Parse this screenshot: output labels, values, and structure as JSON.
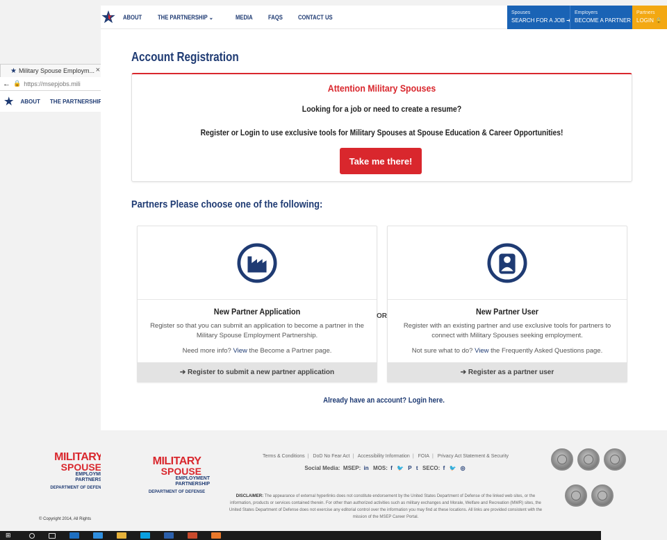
{
  "background_window": {
    "tab_title": "Military Spouse Employm...",
    "address": "https://msepjobs.mili",
    "nav_items": [
      "ABOUT",
      "THE PARTNERSHIP"
    ],
    "footer_copyright": "© Copyright 2014, All Rights"
  },
  "nav": {
    "links": [
      "ABOUT",
      "THE PARTNERSHIP ⌄",
      "MEDIA",
      "FAQS",
      "CONTACT US"
    ],
    "cta_spouses": {
      "small": "Spouses",
      "big": "SEARCH FOR A JOB ➔"
    },
    "cta_employers": {
      "small": "Employers",
      "big": "BECOME A PARTNER ➔"
    },
    "cta_partners": {
      "small": "Partners",
      "big": "LOGIN 🔒"
    }
  },
  "page": {
    "title": "Account Registration",
    "attention": {
      "title": "Attention Military Spouses",
      "line1": "Looking for a job or need to create a resume?",
      "line2": "Register or Login to use exclusive tools for Military Spouses at Spouse Education & Career Opportunities!",
      "button": "Take me there!"
    },
    "partners_heading": "Partners Please choose one of the following:",
    "or_label": "OR",
    "card_application": {
      "title": "New Partner Application",
      "description": "Register so that you can submit an application to become a partner in the Military Spouse Employment Partnership.",
      "more_prefix": "Need more info? ",
      "more_link": "View",
      "more_suffix": " the Become a Partner page.",
      "footer": "➔ Register to submit a new partner application"
    },
    "card_user": {
      "title": "New Partner User",
      "description": "Register with an existing partner and use exclusive tools for partners to connect with Military Spouses seeking employment.",
      "more_prefix": "Not sure what to do? ",
      "more_link": "View",
      "more_suffix": " the Frequently Asked Questions page.",
      "footer": "➔ Register as a partner user"
    },
    "login_link": "Already have an account? Login here."
  },
  "footer": {
    "logo": {
      "word1": "MILITARY",
      "word2": "SPOUSE",
      "line3": "EMPLOYMENT",
      "line4": "PARTNERSHIP",
      "dod": "DEPARTMENT OF DEFENSE"
    },
    "links": [
      "Terms & Conditions",
      "DoD No Fear Act",
      "Accessibility Information",
      "FOIA",
      "Privacy Act Statement & Security"
    ],
    "social_label": "Social Media:",
    "social_msep": "MSEP:",
    "social_mos": "MOS:",
    "social_seco": "SECO:",
    "disclaimer_label": "DISCLAIMER:",
    "disclaimer_text": " The appearance of external hyperlinks does not constitute endorsement by the United States Department of Defense of the linked web sites, or the information, products or services contained therein. For other than authorized activities such as military exchanges and Morale, Welfare and Recreation (MWR) sites, the United States Department of Defense does not exercise any editorial control over the information you may find at these locations. All links are provided consistent with the mission of the MSEP Career Portal."
  },
  "colors": {
    "navy": "#1f3b73",
    "red": "#d9272d",
    "blue_cta": "#1a63b5",
    "gold_cta": "#f3a812"
  },
  "icons": {
    "factory": "factory-icon",
    "user": "user-icon",
    "logo": "star-logo-icon"
  }
}
